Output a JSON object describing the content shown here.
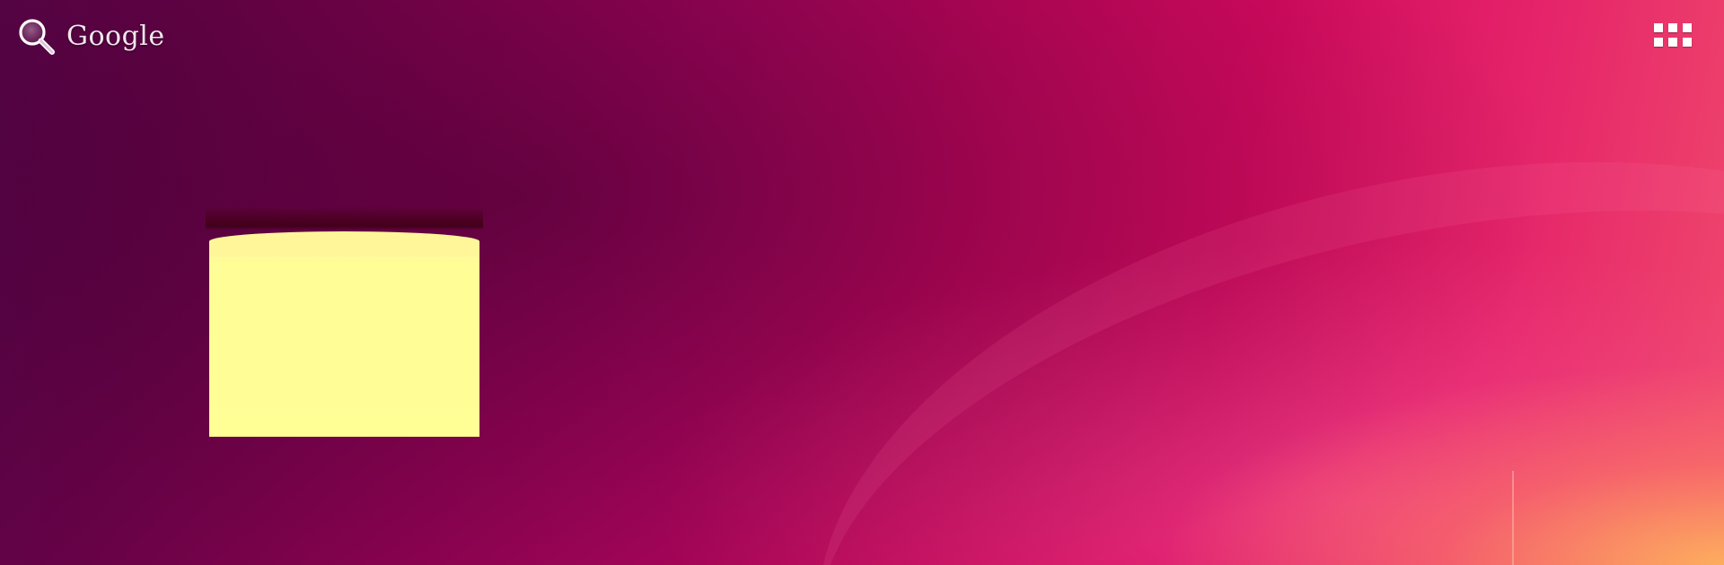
{
  "search": {
    "label": "Google",
    "icon": "search-icon"
  },
  "apps": {
    "icon": "apps-grid-icon"
  },
  "note_widget": {
    "text": "",
    "color": "#ffff96"
  },
  "wallpaper": {
    "colors": [
      "#5c0448",
      "#a8045a",
      "#d40a5e",
      "#f04a6c",
      "#ffbe5a"
    ]
  }
}
